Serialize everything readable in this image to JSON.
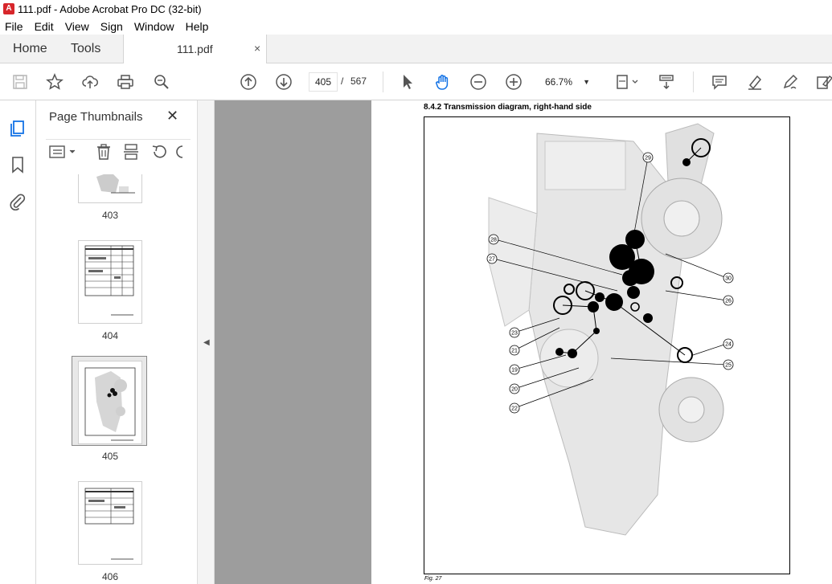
{
  "window": {
    "title": "111.pdf - Adobe Acrobat Pro DC (32-bit)"
  },
  "menu": [
    "File",
    "Edit",
    "View",
    "Sign",
    "Window",
    "Help"
  ],
  "tabs": {
    "home": "Home",
    "tools": "Tools",
    "document": "111.pdf",
    "close": "×"
  },
  "toolbar": {
    "current_page": "405",
    "page_separator": "/",
    "total_pages": "567",
    "zoom": "66.7%"
  },
  "sidebar": {
    "title": "Page Thumbnails",
    "close": "✕",
    "thumbnails": [
      {
        "label": "403"
      },
      {
        "label": "404"
      },
      {
        "label": "405"
      },
      {
        "label": "406"
      }
    ],
    "selected": "405"
  },
  "document": {
    "heading": "8.4.2  Transmission diagram, right-hand side",
    "caption": "Fig. 27",
    "callouts": [
      "29",
      "28",
      "27",
      "30",
      "26",
      "23",
      "21",
      "19",
      "20",
      "22",
      "24",
      "25"
    ]
  },
  "colors": {
    "accent": "#1473e6",
    "pdf_red": "#d7262b",
    "gray_canvas": "#9d9d9d"
  }
}
